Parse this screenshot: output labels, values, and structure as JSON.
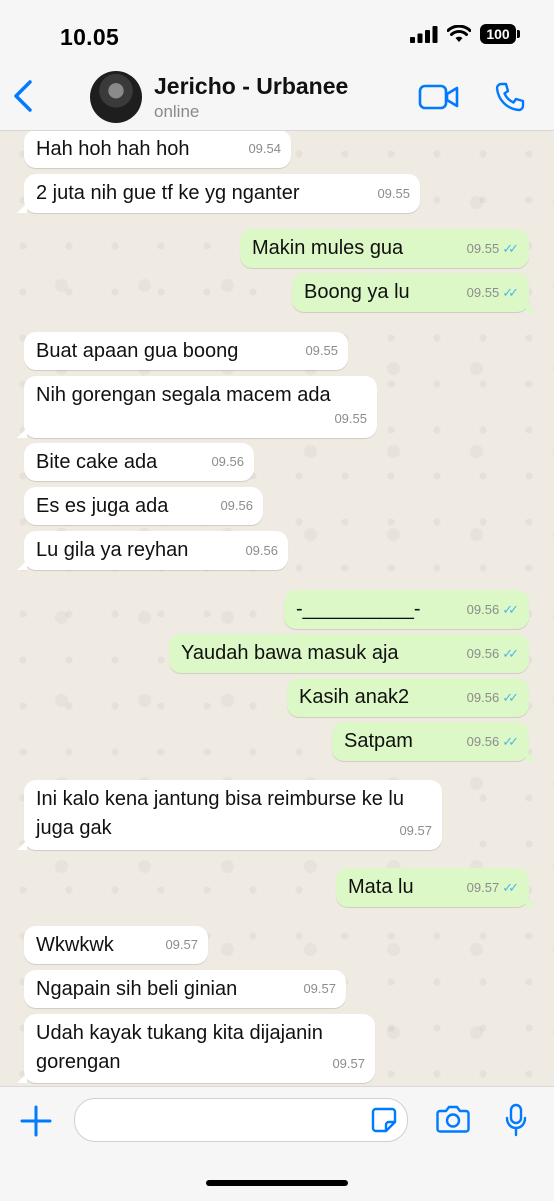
{
  "status_bar": {
    "time": "10.05",
    "battery": "100"
  },
  "header": {
    "name": "Jericho - Urbanee",
    "status": "online"
  },
  "messages": [
    {
      "text": "Hah hoh hah hoh",
      "time": "09.54"
    },
    {
      "text": "2 juta nih gue tf ke yg nganter",
      "time": "09.55"
    },
    {
      "text": "Makin mules gua",
      "time": "09.55"
    },
    {
      "text": "Boong ya lu",
      "time": "09.55"
    },
    {
      "text": "Buat apaan gua boong",
      "time": "09.55"
    },
    {
      "text": "Nih gorengan segala macem ada",
      "time": "09.55"
    },
    {
      "text": "Bite cake ada",
      "time": "09.56"
    },
    {
      "text": "Es es juga ada",
      "time": "09.56"
    },
    {
      "text": "Lu gila ya reyhan",
      "time": "09.56"
    },
    {
      "text": "-__________-",
      "time": "09.56"
    },
    {
      "text": "Yaudah bawa masuk aja",
      "time": "09.56"
    },
    {
      "text": "Kasih anak2",
      "time": "09.56"
    },
    {
      "text": "Satpam",
      "time": "09.56"
    },
    {
      "text": "Ini kalo kena jantung bisa reimburse ke lu juga gak",
      "time": "09.57"
    },
    {
      "text": "Mata lu",
      "time": "09.57"
    },
    {
      "text": "Wkwkwk",
      "time": "09.57"
    },
    {
      "text": "Ngapain sih beli ginian",
      "time": "09.57"
    },
    {
      "text": "Udah kayak tukang kita dijajanin gorengan",
      "time": "09.57"
    }
  ],
  "colors": {
    "accent": "#007aff",
    "incoming": "#ffffff",
    "outgoing": "#dcf8c6",
    "read_ticks": "#4fb6ec"
  }
}
